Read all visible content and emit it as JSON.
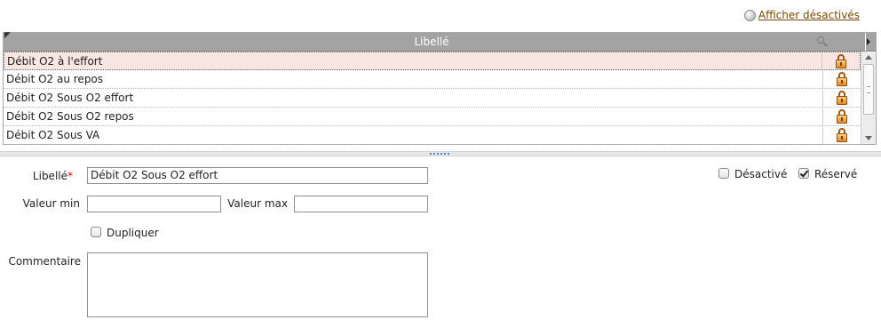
{
  "toolbar": {
    "show_disabled_label": "Afficher désactivés"
  },
  "grid": {
    "column_header": "Libellé",
    "rows": [
      {
        "label": "Débit O2 à l'effort",
        "selected": true
      },
      {
        "label": "Débit O2 au repos"
      },
      {
        "label": "Débit O2 Sous O2 effort"
      },
      {
        "label": "Débit O2 Sous O2 repos"
      },
      {
        "label": "Débit O2 Sous VA"
      }
    ],
    "row_icon": "lock-icon"
  },
  "form": {
    "libelle_label": "Libellé",
    "required_mark": "*",
    "libelle_value": "Débit O2 Sous O2 effort",
    "valeur_min_label": "Valeur min",
    "valeur_min_value": "",
    "valeur_max_label": "Valeur max",
    "valeur_max_value": "",
    "dupliquer_label": "Dupliquer",
    "dupliquer_checked": false,
    "commentaire_label": "Commentaire",
    "commentaire_value": "",
    "desactive_label": "Désactivé",
    "desactive_checked": false,
    "reserve_label": "Réservé",
    "reserve_checked": true
  },
  "colors": {
    "header_bg": "#a3a3a3",
    "selected_row_bg": "#f7e6e2",
    "link": "#7a4a00",
    "required": "#d00000"
  }
}
